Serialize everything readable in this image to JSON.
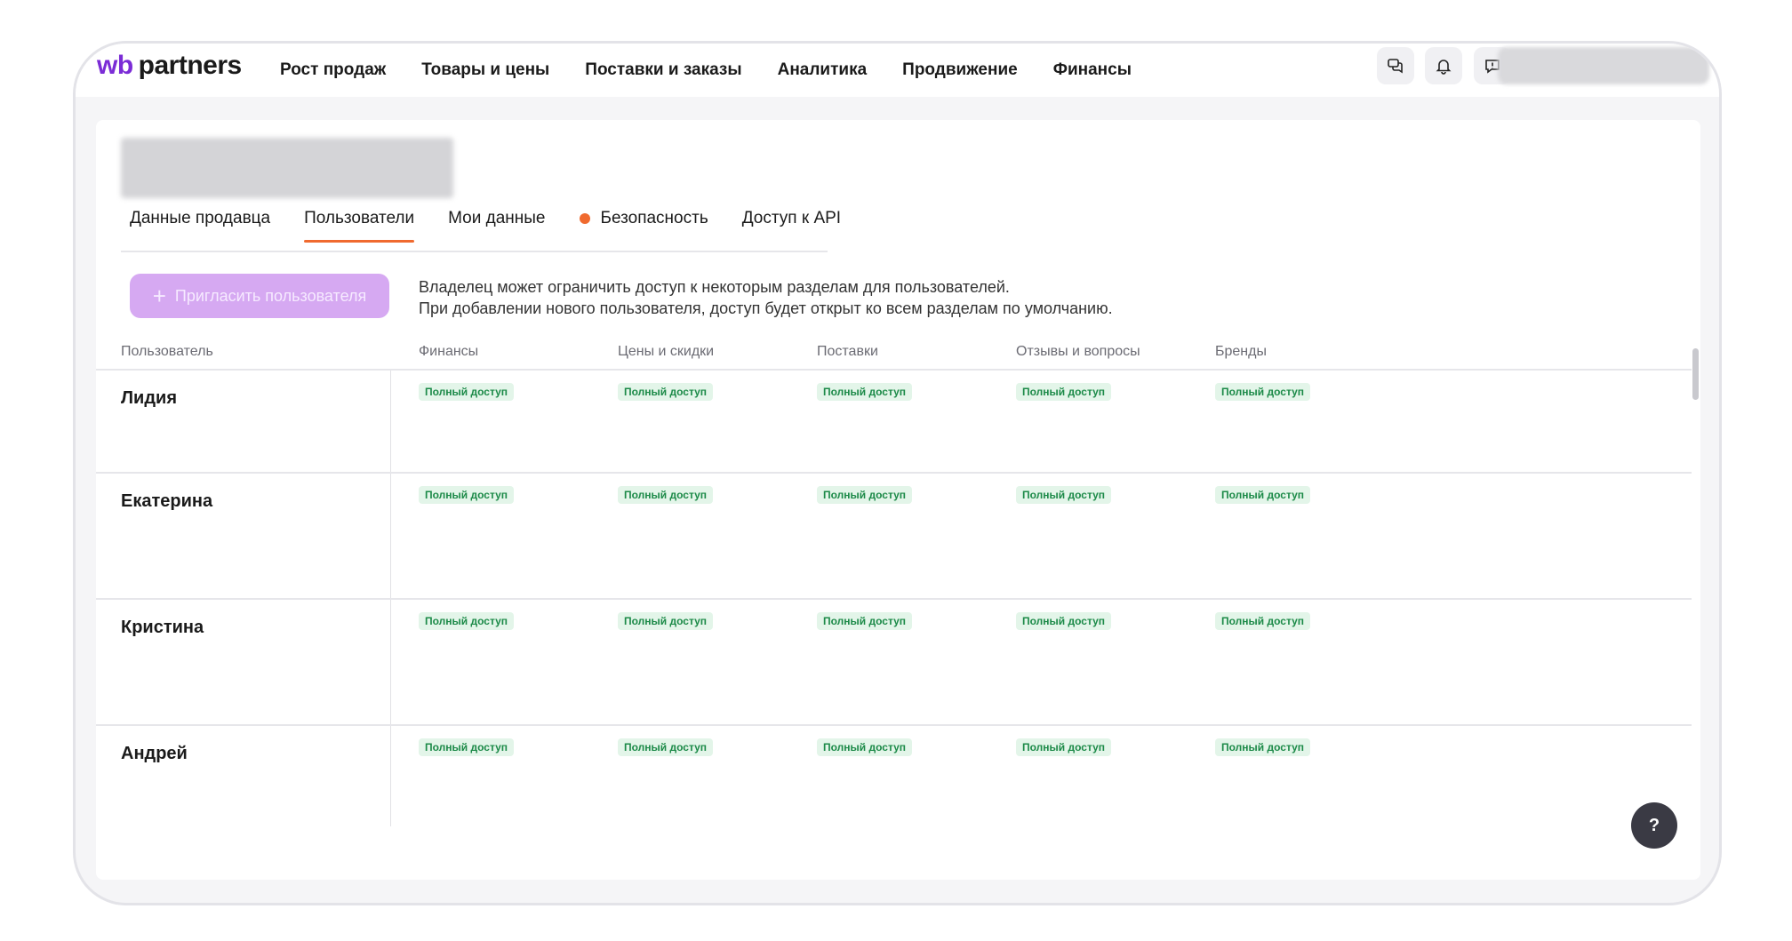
{
  "logo": {
    "wb": "wb",
    "partners": "partners"
  },
  "nav": [
    {
      "label": "Рост продаж"
    },
    {
      "label": "Товары и цены"
    },
    {
      "label": "Поставки и заказы"
    },
    {
      "label": "Аналитика"
    },
    {
      "label": "Продвижение"
    },
    {
      "label": "Финансы"
    }
  ],
  "toolbar": {
    "icons": [
      "chat-icon",
      "bell-icon",
      "feedback-icon"
    ]
  },
  "tabs": [
    {
      "label": "Данные продавца",
      "active": false
    },
    {
      "label": "Пользователи",
      "active": true
    },
    {
      "label": "Мои данные",
      "active": false
    },
    {
      "label": "Безопасность",
      "active": false,
      "indicator": true
    },
    {
      "label": "Доступ к API",
      "active": false
    }
  ],
  "invite_button": {
    "label": "Пригласить пользователя",
    "icon": "plus-icon"
  },
  "info": {
    "line1": "Владелец может ограничить доступ к некоторым разделам для пользователей.",
    "line2": "При добавлении нового пользователя, доступ будет открыт ко всем разделам по умолчанию."
  },
  "table": {
    "columns": [
      "Пользователь",
      "Финансы",
      "Цены и скидки",
      "Поставки",
      "Отзывы и вопросы",
      "Бренды"
    ],
    "rows": [
      {
        "name": "Лидия",
        "access": [
          "Полный доступ",
          "Полный доступ",
          "Полный доступ",
          "Полный доступ",
          "Полный доступ"
        ]
      },
      {
        "name": "Екатерина",
        "access": [
          "Полный доступ",
          "Полный доступ",
          "Полный доступ",
          "Полный доступ",
          "Полный доступ"
        ]
      },
      {
        "name": "Кристина",
        "access": [
          "Полный доступ",
          "Полный доступ",
          "Полный доступ",
          "Полный доступ",
          "Полный доступ"
        ]
      },
      {
        "name": "Андрей",
        "access": [
          "Полный доступ",
          "Полный доступ",
          "Полный доступ",
          "Полный доступ",
          "Полный доступ"
        ]
      }
    ]
  },
  "help": {
    "label": "?"
  },
  "colors": {
    "brand": "#7b2cd6",
    "accent": "#f06a2f",
    "invite_bg": "#d6a9f2",
    "badge_bg": "#e3f5e9",
    "badge_text": "#1c8a48"
  }
}
